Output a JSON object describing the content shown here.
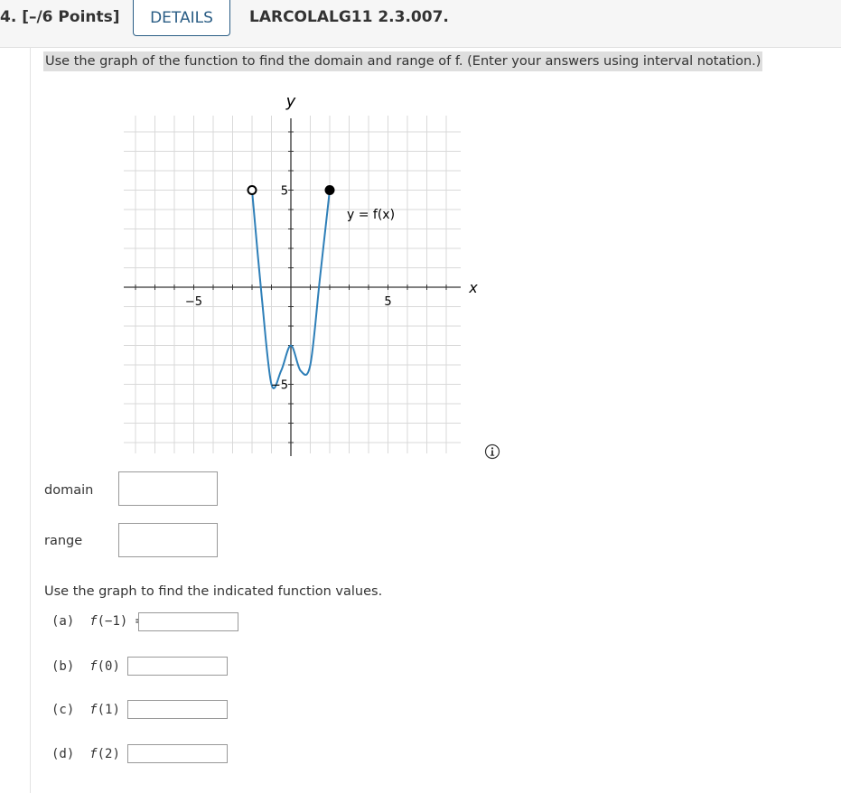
{
  "header": {
    "question_number": "4. [–/6 Points]",
    "details_label": "DETAILS",
    "question_code": "LARCOLALG11 2.3.007."
  },
  "prompt": "Use the graph of the function to find the domain and range of f. (Enter your answers using interval notation.)",
  "graph": {
    "y_axis_label": "y",
    "x_axis_label": "x",
    "curve_label": "y = f(x)",
    "x_tick_neg": "−5",
    "x_tick_pos": "5",
    "y_tick_pos": "5",
    "y_tick_neg": "−5"
  },
  "chart_data": {
    "type": "line",
    "xlim": [
      -8,
      8
    ],
    "ylim": [
      -8,
      8
    ],
    "grid": true,
    "series": [
      {
        "name": "y = f(x)",
        "color": "#2e7fb8",
        "x": [
          -2,
          -1.5,
          -1,
          -0.5,
          0,
          0.5,
          1,
          1.5,
          2
        ],
        "y": [
          5,
          -0.5,
          -5,
          -4.3,
          -3,
          -4.3,
          -4,
          0.5,
          5
        ]
      }
    ],
    "endpoints": [
      {
        "x": -2,
        "y": 5,
        "style": "open"
      },
      {
        "x": 2,
        "y": 5,
        "style": "closed"
      }
    ]
  },
  "info_icon": "info-icon",
  "domain": {
    "label": "domain",
    "value": ""
  },
  "range": {
    "label": "range",
    "value": ""
  },
  "function_values": {
    "prompt": "Use the graph to find the indicated function values.",
    "parts": [
      {
        "prefix": "(a)",
        "fn": "f",
        "arg": "(−1) =",
        "value": ""
      },
      {
        "prefix": "(b)",
        "fn": "f",
        "arg": "(0) =",
        "value": ""
      },
      {
        "prefix": "(c)",
        "fn": "f",
        "arg": "(1) =",
        "value": ""
      },
      {
        "prefix": "(d)",
        "fn": "f",
        "arg": "(2) =",
        "value": ""
      }
    ]
  },
  "colors": {
    "accent": "#2a5d85",
    "curve": "#2e7fb8"
  }
}
